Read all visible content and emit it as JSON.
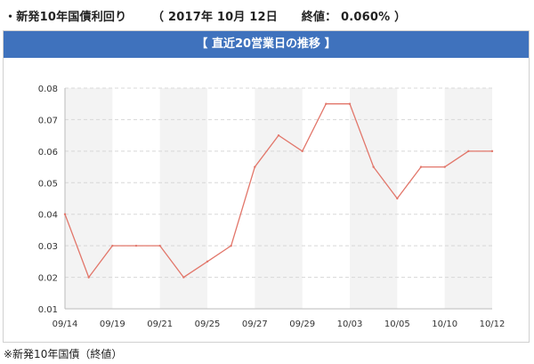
{
  "headline": {
    "title": "・新発10年国債利回り",
    "date": "（ 2017年 10月 12日",
    "close": "終値： 0.060% ）"
  },
  "panel": {
    "bar_title": "【 直近20営業日の推移 】"
  },
  "footnote": "※新発10年国債（終値）",
  "colors": {
    "header_bar": "#3f72bd",
    "line": "#e2766a",
    "band": "#f3f3f3",
    "grid": "#d8d8d8"
  },
  "chart_data": {
    "type": "line",
    "title": "",
    "xlabel": "",
    "ylabel": "",
    "ylim": [
      0.01,
      0.08
    ],
    "yticks": [
      "0.01",
      "0.02",
      "0.03",
      "0.04",
      "0.05",
      "0.06",
      "0.07",
      "0.08"
    ],
    "xticks": [
      "09/14",
      "09/19",
      "09/21",
      "09/25",
      "09/27",
      "09/29",
      "10/03",
      "10/05",
      "10/10",
      "10/12"
    ],
    "grid": true,
    "series": [
      {
        "values": [
          0.04,
          0.02,
          0.03,
          0.03,
          0.03,
          0.02,
          0.025,
          0.03,
          0.055,
          0.065,
          0.06,
          0.075,
          0.075,
          0.055,
          0.045,
          0.055,
          0.055,
          0.06,
          0.06
        ]
      }
    ]
  }
}
